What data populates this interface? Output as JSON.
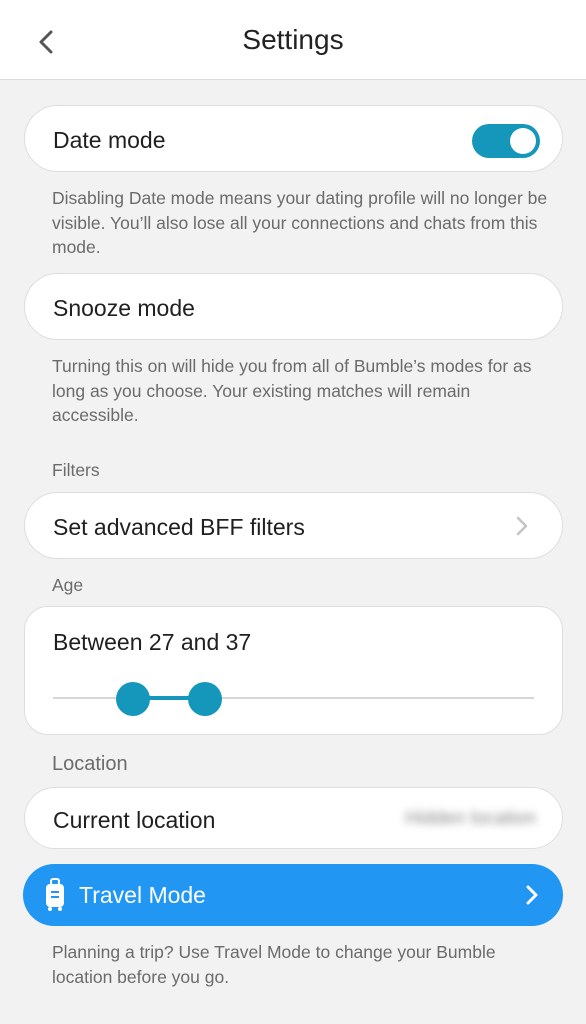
{
  "header": {
    "title": "Settings",
    "back_icon": "chevron-left-icon"
  },
  "colors": {
    "accent": "#1596bb",
    "travel_blue": "#2196f3",
    "text_muted": "#6b6b6b"
  },
  "date_mode": {
    "label": "Date mode",
    "enabled": true,
    "description": "Disabling Date mode means your dating profile will no longer be visible. You’ll also lose all your connections and chats from this mode."
  },
  "snooze_mode": {
    "label": "Snooze mode",
    "description": "Turning this on will hide you from all of Bumble’s modes for as long as you choose. Your existing matches will remain accessible."
  },
  "filters": {
    "section_label": "Filters",
    "advanced_label": "Set advanced BFF filters",
    "chevron_icon": "chevron-right-icon"
  },
  "age": {
    "section_label": "Age",
    "range_text": "Between 27 and 37",
    "min": 27,
    "max": 37
  },
  "location": {
    "section_label": "Location",
    "current_label": "Current location",
    "current_value": "Hidden location",
    "travel_mode_label": "Travel Mode",
    "travel_icon": "luggage-icon",
    "travel_description": "Planning a trip? Use Travel Mode to change your Bumble location before you go."
  }
}
